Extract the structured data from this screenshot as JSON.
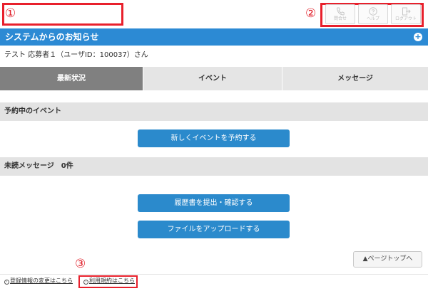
{
  "annotations": {
    "mark1": "①",
    "mark2": "②",
    "mark3": "③"
  },
  "header": {
    "buttons": [
      {
        "label": "問合せ",
        "icon": "phone-icon"
      },
      {
        "label": "ヘルプ",
        "icon": "help-icon"
      },
      {
        "label": "ログアウト",
        "icon": "logout-icon"
      }
    ]
  },
  "notice": {
    "title": "システムからのお知らせ",
    "toggle": "+"
  },
  "user": {
    "line": "テスト 応募者１（ユーザID：100037）さん"
  },
  "tabs": [
    {
      "label": "最新状況",
      "active": true
    },
    {
      "label": "イベント",
      "active": false
    },
    {
      "label": "メッセージ",
      "active": false
    }
  ],
  "sections": {
    "events": {
      "title": "予約中のイベント",
      "button": "新しくイベントを予約する"
    },
    "messages": {
      "title": "未読メッセージ　0件"
    }
  },
  "actions": {
    "resume": "履歴書を提出・確認する",
    "upload": "ファイルをアップロードする"
  },
  "pagetop": {
    "label": "▲ページトップへ"
  },
  "footer": {
    "link1": "登録情報の変更はこちら",
    "link2": "利用規約はこちら",
    "link_icon": "›"
  },
  "colors": {
    "primary": "#2c8ad4",
    "highlight": "#e8202c",
    "active_tab": "#808080"
  }
}
